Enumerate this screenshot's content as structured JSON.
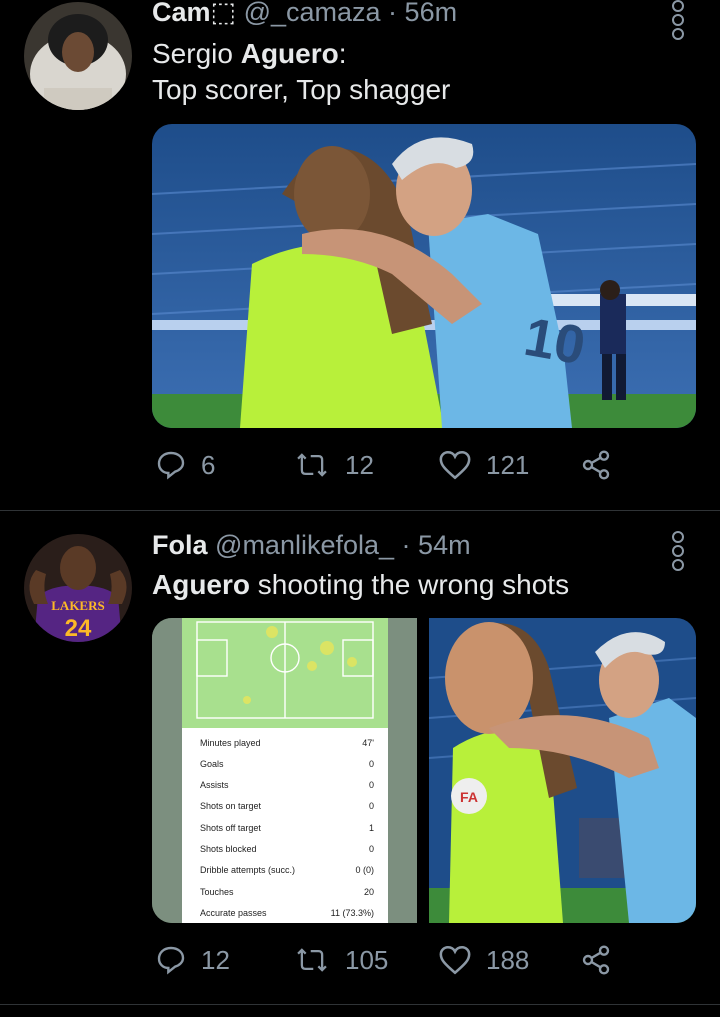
{
  "tweets": [
    {
      "name": "Cam⬚",
      "handle": "@_camaza",
      "time": "56m",
      "text_bold": "Sergio Aguero",
      "text_after_bold": ":",
      "text_line2": "Top scorer, Top shagger",
      "replies": "6",
      "retweets": "12",
      "likes": "121"
    },
    {
      "name": "Fola",
      "handle": "@manlikefola_",
      "time": "54m",
      "text_bold": "Aguero",
      "text_rest": " shooting the wrong shots",
      "stats": [
        {
          "label": "Minutes played",
          "value": "47'"
        },
        {
          "label": "Goals",
          "value": "0"
        },
        {
          "label": "Assists",
          "value": "0"
        },
        {
          "label": "Shots on target",
          "value": "0"
        },
        {
          "label": "Shots off target",
          "value": "1"
        },
        {
          "label": "Shots blocked",
          "value": "0"
        },
        {
          "label": "Dribble attempts (succ.)",
          "value": "0 (0)"
        },
        {
          "label": "Touches",
          "value": "20"
        },
        {
          "label": "Accurate passes",
          "value": "11 (73.3%)"
        }
      ],
      "replies": "12",
      "retweets": "105",
      "likes": "188"
    }
  ],
  "colors": {
    "background": "#000000",
    "text": "#e7e9ea",
    "muted": "#8b98a5",
    "divider": "#2f3336",
    "kit_sky_blue": "#6cb7e6",
    "referee_yellow": "#b8f03a",
    "pitch_green": "#a8e08e"
  },
  "icons": [
    "reply-icon",
    "retweet-icon",
    "like-icon",
    "share-icon",
    "more-icon"
  ]
}
